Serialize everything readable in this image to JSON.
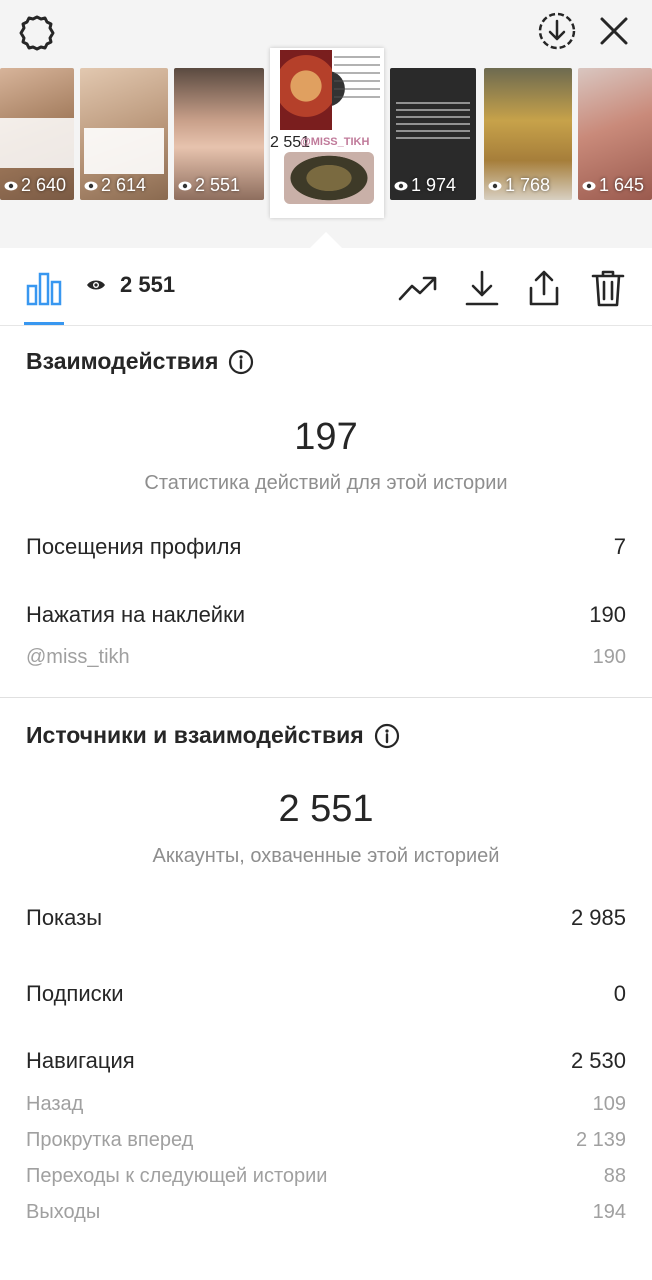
{
  "header": {
    "settings_icon": "gear-icon",
    "download_icon": "download-circle-icon",
    "close_icon": "close-icon"
  },
  "thumbnails": [
    {
      "views": "2 640",
      "color": "#b08a6a"
    },
    {
      "views": "2 614",
      "color": "#c2a488"
    },
    {
      "views": "2 551",
      "color": "#6b5b4e"
    },
    {
      "views": "2 551",
      "color": "#ffffff",
      "selected": true,
      "handle": "@MISS_TIKH"
    },
    {
      "views": "1 974",
      "color": "#2b2b2b"
    },
    {
      "views": "1 768",
      "color": "#8c7a54"
    },
    {
      "views": "1 645",
      "color": "#b56a5e"
    }
  ],
  "toolbar": {
    "reach": "2 551",
    "icons": [
      "bar-chart-icon",
      "eye-icon",
      "trend-icon",
      "download-icon",
      "share-icon",
      "trash-icon"
    ],
    "accent": "#3897f0"
  },
  "interactions": {
    "title": "Взаимодействия",
    "total": "197",
    "total_caption": "Статистика действий для этой истории",
    "rows": [
      {
        "label": "Посещения профиля",
        "value": "7"
      },
      {
        "label": "Нажатия на наклейки",
        "value": "190"
      }
    ],
    "sticker_rows": [
      {
        "label": "@miss_tikh",
        "value": "190"
      }
    ]
  },
  "discovery": {
    "title": "Источники и взаимодействия",
    "total": "2 551",
    "total_caption": "Аккаунты, охваченные этой историей",
    "rows": [
      {
        "label": "Показы",
        "value": "2 985"
      },
      {
        "label": "Подписки",
        "value": "0"
      },
      {
        "label": "Навигация",
        "value": "2 530"
      }
    ],
    "nav_rows": [
      {
        "label": "Назад",
        "value": "109"
      },
      {
        "label": "Прокрутка вперед",
        "value": "2 139"
      },
      {
        "label": "Переходы к следующей истории",
        "value": "88"
      },
      {
        "label": "Выходы",
        "value": "194"
      }
    ]
  }
}
